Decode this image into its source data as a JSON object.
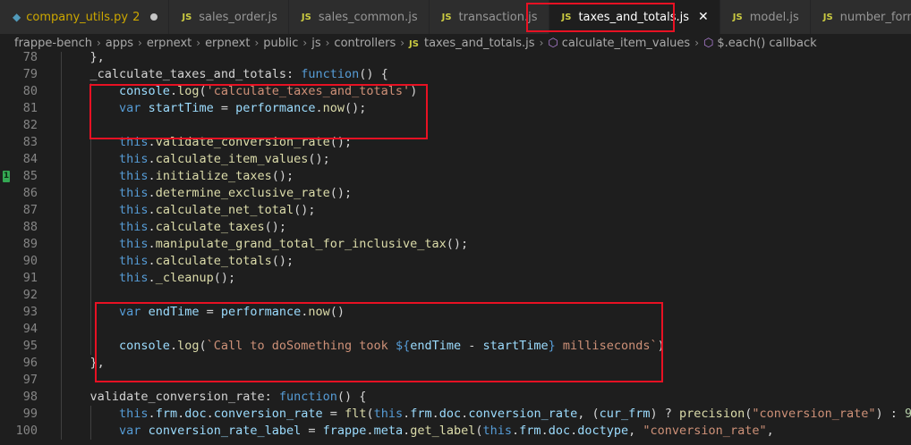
{
  "tabs": [
    {
      "label": "company_utils.py",
      "icon": "python-file-icon",
      "badge": "2",
      "modified": true,
      "active": false
    },
    {
      "label": "sales_order.js",
      "icon": "js-file-icon",
      "active": false
    },
    {
      "label": "sales_common.js",
      "icon": "js-file-icon",
      "active": false
    },
    {
      "label": "transaction.js",
      "icon": "js-file-icon",
      "active": false
    },
    {
      "label": "taxes_and_totals.js",
      "icon": "js-file-icon",
      "active": true
    },
    {
      "label": "model.js",
      "icon": "js-file-icon",
      "active": false
    },
    {
      "label": "number_format.js",
      "icon": "js-file-icon",
      "active": false
    }
  ],
  "js_icon_text": "JS",
  "close_glyph": "✕",
  "breadcrumb": [
    {
      "label": "frappe-bench"
    },
    {
      "label": "apps"
    },
    {
      "label": "erpnext"
    },
    {
      "label": "erpnext"
    },
    {
      "label": "public"
    },
    {
      "label": "js"
    },
    {
      "label": "controllers"
    },
    {
      "label": "taxes_and_totals.js",
      "icon": "js-file-icon"
    },
    {
      "label": "calculate_item_values",
      "icon": "method-cube-icon"
    },
    {
      "label": "$.each() callback",
      "icon": "method-cube-icon"
    }
  ],
  "gutter_marker_line": 85,
  "gutter_marker_text": "1",
  "colors": {
    "highlight_box": "#e81123",
    "keyword": "#569cd6",
    "function": "#dcdcaa",
    "string": "#ce9178",
    "variable": "#9cdcfe",
    "class": "#4ec9b0"
  },
  "code_lines": [
    {
      "n": "78",
      "indent": 1,
      "tokens": [
        [
          "pn",
          "},"
        ]
      ],
      "clip": true
    },
    {
      "n": "79",
      "indent": 1,
      "tokens": [
        [
          "pn",
          "_calculate_taxes_and_totals: "
        ],
        [
          "kw",
          "function"
        ],
        [
          "pn",
          "() {"
        ]
      ]
    },
    {
      "n": "80",
      "indent": 2,
      "tokens": [
        [
          "var",
          "console"
        ],
        [
          "pn",
          "."
        ],
        [
          "fn",
          "log"
        ],
        [
          "pn",
          "("
        ],
        [
          "str",
          "'calculate_taxes_and_totals'"
        ],
        [
          "pn",
          ")"
        ]
      ]
    },
    {
      "n": "81",
      "indent": 2,
      "tokens": [
        [
          "kw",
          "var"
        ],
        [
          "pn",
          " "
        ],
        [
          "var",
          "startTime"
        ],
        [
          "pn",
          " = "
        ],
        [
          "var",
          "performance"
        ],
        [
          "pn",
          "."
        ],
        [
          "fn",
          "now"
        ],
        [
          "pn",
          "();"
        ]
      ]
    },
    {
      "n": "82",
      "indent": 2,
      "tokens": []
    },
    {
      "n": "83",
      "indent": 2,
      "tokens": [
        [
          "kw",
          "this"
        ],
        [
          "pn",
          "."
        ],
        [
          "fn",
          "validate_conversion_rate"
        ],
        [
          "pn",
          "();"
        ]
      ]
    },
    {
      "n": "84",
      "indent": 2,
      "tokens": [
        [
          "kw",
          "this"
        ],
        [
          "pn",
          "."
        ],
        [
          "fn",
          "calculate_item_values"
        ],
        [
          "pn",
          "();"
        ]
      ]
    },
    {
      "n": "85",
      "indent": 2,
      "tokens": [
        [
          "kw",
          "this"
        ],
        [
          "pn",
          "."
        ],
        [
          "fn",
          "initialize_taxes"
        ],
        [
          "pn",
          "();"
        ]
      ]
    },
    {
      "n": "86",
      "indent": 2,
      "tokens": [
        [
          "kw",
          "this"
        ],
        [
          "pn",
          "."
        ],
        [
          "fn",
          "determine_exclusive_rate"
        ],
        [
          "pn",
          "();"
        ]
      ]
    },
    {
      "n": "87",
      "indent": 2,
      "tokens": [
        [
          "kw",
          "this"
        ],
        [
          "pn",
          "."
        ],
        [
          "fn",
          "calculate_net_total"
        ],
        [
          "pn",
          "();"
        ]
      ]
    },
    {
      "n": "88",
      "indent": 2,
      "tokens": [
        [
          "kw",
          "this"
        ],
        [
          "pn",
          "."
        ],
        [
          "fn",
          "calculate_taxes"
        ],
        [
          "pn",
          "();"
        ]
      ]
    },
    {
      "n": "89",
      "indent": 2,
      "tokens": [
        [
          "kw",
          "this"
        ],
        [
          "pn",
          "."
        ],
        [
          "fn",
          "manipulate_grand_total_for_inclusive_tax"
        ],
        [
          "pn",
          "();"
        ]
      ]
    },
    {
      "n": "90",
      "indent": 2,
      "tokens": [
        [
          "kw",
          "this"
        ],
        [
          "pn",
          "."
        ],
        [
          "fn",
          "calculate_totals"
        ],
        [
          "pn",
          "();"
        ]
      ]
    },
    {
      "n": "91",
      "indent": 2,
      "tokens": [
        [
          "kw",
          "this"
        ],
        [
          "pn",
          "."
        ],
        [
          "fn",
          "_cleanup"
        ],
        [
          "pn",
          "();"
        ]
      ]
    },
    {
      "n": "92",
      "indent": 2,
      "tokens": []
    },
    {
      "n": "93",
      "indent": 2,
      "tokens": [
        [
          "kw",
          "var"
        ],
        [
          "pn",
          " "
        ],
        [
          "var",
          "endTime"
        ],
        [
          "pn",
          " = "
        ],
        [
          "var",
          "performance"
        ],
        [
          "pn",
          "."
        ],
        [
          "fn",
          "now"
        ],
        [
          "pn",
          "()"
        ]
      ]
    },
    {
      "n": "94",
      "indent": 2,
      "tokens": []
    },
    {
      "n": "95",
      "indent": 2,
      "tokens": [
        [
          "var",
          "console"
        ],
        [
          "pn",
          "."
        ],
        [
          "fn",
          "log"
        ],
        [
          "pn",
          "("
        ],
        [
          "str",
          "`Call to doSomething took "
        ],
        [
          "kw",
          "${"
        ],
        [
          "var",
          "endTime"
        ],
        [
          "pn",
          " - "
        ],
        [
          "var",
          "startTime"
        ],
        [
          "kw",
          "}"
        ],
        [
          "str",
          " milliseconds`"
        ],
        [
          "pn",
          ")"
        ]
      ]
    },
    {
      "n": "96",
      "indent": 1,
      "tokens": [
        [
          "pn",
          "},"
        ]
      ]
    },
    {
      "n": "97",
      "indent": 1,
      "tokens": []
    },
    {
      "n": "98",
      "indent": 1,
      "tokens": [
        [
          "pn",
          "validate_conversion_rate: "
        ],
        [
          "kw",
          "function"
        ],
        [
          "pn",
          "() {"
        ]
      ]
    },
    {
      "n": "99",
      "indent": 2,
      "tokens": [
        [
          "kw",
          "this"
        ],
        [
          "pn",
          "."
        ],
        [
          "prop",
          "frm"
        ],
        [
          "pn",
          "."
        ],
        [
          "prop",
          "doc"
        ],
        [
          "pn",
          "."
        ],
        [
          "prop",
          "conversion_rate"
        ],
        [
          "pn",
          " = "
        ],
        [
          "fn",
          "flt"
        ],
        [
          "pn",
          "("
        ],
        [
          "kw",
          "this"
        ],
        [
          "pn",
          "."
        ],
        [
          "prop",
          "frm"
        ],
        [
          "pn",
          "."
        ],
        [
          "prop",
          "doc"
        ],
        [
          "pn",
          "."
        ],
        [
          "prop",
          "conversion_rate"
        ],
        [
          "pn",
          ", ("
        ],
        [
          "var",
          "cur_frm"
        ],
        [
          "pn",
          ") ? "
        ],
        [
          "fn",
          "precision"
        ],
        [
          "pn",
          "("
        ],
        [
          "str",
          "\"conversion_rate\""
        ],
        [
          "pn",
          ") : "
        ],
        [
          "num",
          "9"
        ],
        [
          "pn",
          ");"
        ]
      ]
    },
    {
      "n": "100",
      "indent": 2,
      "tokens": [
        [
          "kw",
          "var"
        ],
        [
          "pn",
          " "
        ],
        [
          "var",
          "conversion_rate_label"
        ],
        [
          "pn",
          " = "
        ],
        [
          "var",
          "frappe"
        ],
        [
          "pn",
          "."
        ],
        [
          "prop",
          "meta"
        ],
        [
          "pn",
          "."
        ],
        [
          "fn",
          "get_label"
        ],
        [
          "pn",
          "("
        ],
        [
          "kw",
          "this"
        ],
        [
          "pn",
          "."
        ],
        [
          "prop",
          "frm"
        ],
        [
          "pn",
          "."
        ],
        [
          "prop",
          "doc"
        ],
        [
          "pn",
          "."
        ],
        [
          "prop",
          "doctype"
        ],
        [
          "pn",
          ", "
        ],
        [
          "str",
          "\"conversion_rate\""
        ],
        [
          "pn",
          ","
        ]
      ]
    }
  ]
}
